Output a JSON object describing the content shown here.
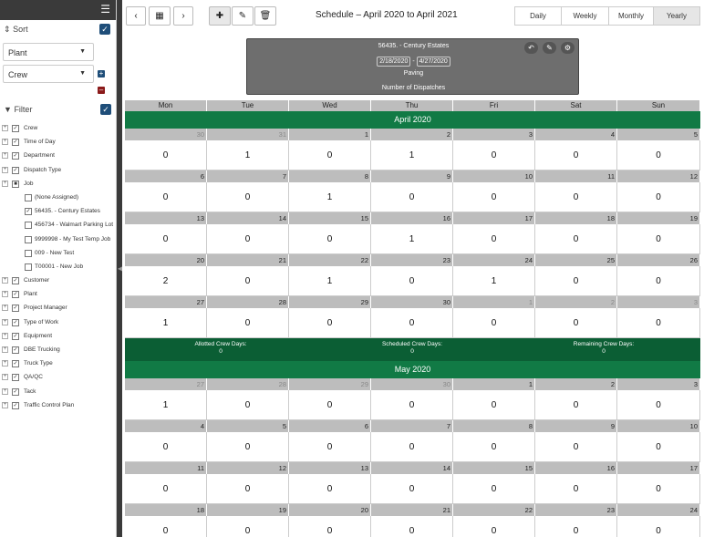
{
  "sidebar": {
    "sort_label": "Sort",
    "sort_field": "Plant",
    "group_field": "Crew",
    "filter_label": "Filter",
    "tree": [
      {
        "label": "Crew",
        "checked": true,
        "level": 0
      },
      {
        "label": "Time of Day",
        "checked": true,
        "level": 0
      },
      {
        "label": "Department",
        "checked": true,
        "level": 0
      },
      {
        "label": "Dispatch Type",
        "checked": true,
        "level": 0
      },
      {
        "label": "Job",
        "checked": "partial",
        "level": 0
      },
      {
        "label": "(None Assigned)",
        "checked": false,
        "level": 1
      },
      {
        "label": "56435. - Century Estates",
        "checked": true,
        "level": 1
      },
      {
        "label": "456734 - Walmart Parking Lot",
        "checked": false,
        "level": 1
      },
      {
        "label": "9999998 - My Test Temp Job",
        "checked": false,
        "level": 1
      },
      {
        "label": "009 - New Test",
        "checked": false,
        "level": 1
      },
      {
        "label": "T00001 - New Job",
        "checked": false,
        "level": 1
      },
      {
        "label": "Customer",
        "checked": true,
        "level": 0
      },
      {
        "label": "Plant",
        "checked": true,
        "level": 0
      },
      {
        "label": "Project Manager",
        "checked": true,
        "level": 0
      },
      {
        "label": "Type of Work",
        "checked": true,
        "level": 0
      },
      {
        "label": "Equipment",
        "checked": true,
        "level": 0
      },
      {
        "label": "DBE Trucking",
        "checked": true,
        "level": 0
      },
      {
        "label": "Truck Type",
        "checked": true,
        "level": 0
      },
      {
        "label": "QA/QC",
        "checked": true,
        "level": 0
      },
      {
        "label": "Tack",
        "checked": true,
        "level": 0
      },
      {
        "label": "Traffic Control Plan",
        "checked": true,
        "level": 0
      }
    ]
  },
  "header": {
    "title": "Schedule – April 2020 to April 2021",
    "views": [
      "Daily",
      "Weekly",
      "Monthly",
      "Yearly"
    ],
    "active_view": "Yearly"
  },
  "card": {
    "job": "56435. - Century Estates",
    "start": "2/18/2020",
    "sep": "-",
    "end": "4/27/2020",
    "work": "Paving",
    "metric": "Number of Dispatches"
  },
  "calendar": {
    "dow": [
      "Mon",
      "Tue",
      "Wed",
      "Thu",
      "Fri",
      "Sat",
      "Sun"
    ],
    "months": [
      {
        "name": "April 2020",
        "weeks": [
          {
            "days": [
              30,
              31,
              1,
              2,
              3,
              4,
              5
            ],
            "out": [
              true,
              true,
              false,
              false,
              false,
              false,
              false
            ],
            "vals": [
              0,
              1,
              0,
              1,
              0,
              0,
              0
            ]
          },
          {
            "days": [
              6,
              7,
              8,
              9,
              10,
              11,
              12
            ],
            "out": [
              false,
              false,
              false,
              false,
              false,
              false,
              false
            ],
            "vals": [
              0,
              0,
              1,
              0,
              0,
              0,
              0
            ]
          },
          {
            "days": [
              13,
              14,
              15,
              16,
              17,
              18,
              19
            ],
            "out": [
              false,
              false,
              false,
              false,
              false,
              false,
              false
            ],
            "vals": [
              0,
              0,
              0,
              1,
              0,
              0,
              0
            ]
          },
          {
            "days": [
              20,
              21,
              22,
              23,
              24,
              25,
              26
            ],
            "out": [
              false,
              false,
              false,
              false,
              false,
              false,
              false
            ],
            "vals": [
              2,
              0,
              1,
              0,
              1,
              0,
              0
            ]
          },
          {
            "days": [
              27,
              28,
              29,
              30,
              1,
              2,
              3
            ],
            "out": [
              false,
              false,
              false,
              false,
              true,
              true,
              true
            ],
            "vals": [
              1,
              0,
              0,
              0,
              0,
              0,
              0
            ]
          }
        ],
        "summary": {
          "allotted_label": "Allotted Crew Days:",
          "allotted": "0",
          "scheduled_label": "Scheduled Crew Days:",
          "scheduled": "0",
          "remaining_label": "Remaining Crew Days:",
          "remaining": "0"
        }
      },
      {
        "name": "May 2020",
        "weeks": [
          {
            "days": [
              27,
              28,
              29,
              30,
              1,
              2,
              3
            ],
            "out": [
              true,
              true,
              true,
              true,
              false,
              false,
              false
            ],
            "vals": [
              1,
              0,
              0,
              0,
              0,
              0,
              0
            ]
          },
          {
            "days": [
              4,
              5,
              6,
              7,
              8,
              9,
              10
            ],
            "out": [
              false,
              false,
              false,
              false,
              false,
              false,
              false
            ],
            "vals": [
              0,
              0,
              0,
              0,
              0,
              0,
              0
            ]
          },
          {
            "days": [
              11,
              12,
              13,
              14,
              15,
              16,
              17
            ],
            "out": [
              false,
              false,
              false,
              false,
              false,
              false,
              false
            ],
            "vals": [
              0,
              0,
              0,
              0,
              0,
              0,
              0
            ]
          },
          {
            "days": [
              18,
              19,
              20,
              21,
              22,
              23,
              24
            ],
            "out": [
              false,
              false,
              false,
              false,
              false,
              false,
              false
            ],
            "vals": [
              0,
              0,
              0,
              0,
              0,
              0,
              0
            ]
          }
        ]
      }
    ]
  }
}
